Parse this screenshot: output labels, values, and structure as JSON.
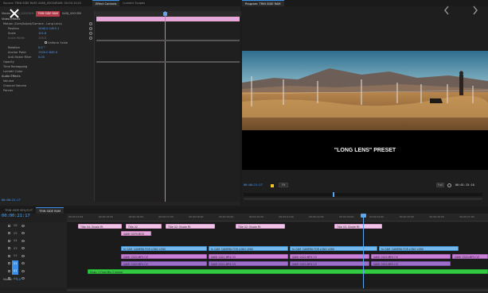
{
  "source_panel": {
    "header_text": "Source: TRIN SIDE RAM: SAMJ_00034RAM: 00:00:14:01",
    "tabs": [
      "Effect Controls",
      "Lumetri Scopes"
    ],
    "subtabs": [
      "Master",
      "TAMJ_00001RM",
      "TRIN SIDE RAM",
      "SAMJ_0001RM"
    ],
    "video_effects_label": "Video Effects",
    "effect_rows": [
      {
        "label": "Motion (Cam/Adjust/Camera - Long Lens)",
        "value": ""
      },
      {
        "label": "Position",
        "value": "1040.0  1455.1"
      },
      {
        "label": "Scale",
        "value": "101.6"
      },
      {
        "label": "Scale Width",
        "value": "100.0"
      },
      {
        "label": "Uniform Scale",
        "value": ""
      },
      {
        "label": "Rotation",
        "value": "0.0 °"
      },
      {
        "label": "Anchor Point",
        "value": "1320.0  849.0"
      },
      {
        "label": "Anti-flicker Filter",
        "value": "0.00"
      },
      {
        "label": "Opacity",
        "value": ""
      },
      {
        "label": "Time Remapping",
        "value": ""
      },
      {
        "label": "Lumetri Color",
        "value": ""
      }
    ],
    "audio_effects_label": "Audio Effects",
    "audio_rows": [
      "Volume",
      "Channel Volume",
      "Panner"
    ],
    "timecode": "00:00:21:17"
  },
  "program_monitor": {
    "title": "Program: TRIN SIDE RAM",
    "caption": "\"LONG LENS\" PRESET",
    "timecode": "00:00:21:17",
    "fit_label": "Fit",
    "full_label": "Full",
    "duration": "00:01:15:10"
  },
  "timeline": {
    "tabs": [
      "TRIN SIDE SEQ/CUT",
      "TRIN SIDE RAM"
    ],
    "timecode": "00:00:21:17",
    "ruler_ticks": [
      "00:00:14:04",
      "00:00:15:00",
      "00:00:16:00",
      "00:00:17:00",
      "00:00:18:00",
      "00:00:19:00",
      "00:00:20:00",
      "00:00:21:00",
      "00:00:22:00",
      "00:00:23:00",
      "00:00:24:00",
      "00:00:25:00",
      "00:00:26:00",
      "00:00:27:00"
    ],
    "tracks": [
      {
        "name": "V6"
      },
      {
        "name": "V5"
      },
      {
        "name": "V4"
      },
      {
        "name": "V3"
      },
      {
        "name": "V2"
      },
      {
        "name": "V1"
      },
      {
        "name": "A1"
      },
      {
        "name": "A2"
      }
    ],
    "master_label": "Master",
    "master_value": "0.0",
    "clips": [
      {
        "label": "Title 04: Single Fit",
        "track": 0,
        "color": "pinklight"
      },
      {
        "label": "Title 02",
        "track": 0,
        "color": "pinklight"
      },
      {
        "label": "Title 02: Single Fit",
        "track": 0,
        "color": "pinklight"
      },
      {
        "label": "Title 02: Single Fit",
        "track": 0,
        "color": "pinklight"
      },
      {
        "label": "Title 03: Single Fit",
        "track": 0,
        "color": "pinklight"
      },
      {
        "label": "SAMJ_0079.MOV",
        "track": 1,
        "color": "pink"
      },
      {
        "label": "fx CAM_CAMERA FOR LONG LENS",
        "track": 3,
        "color": "blue"
      },
      {
        "label": "fx CAM_CAMERA FOR LONG LENS",
        "track": 3,
        "color": "blue"
      },
      {
        "label": "fx CAM_CAMERA FOR LONG LENS",
        "track": 3,
        "color": "blue"
      },
      {
        "label": "fx CAM_CAMERA FOR LONG LENS",
        "track": 3,
        "color": "blue"
      },
      {
        "label": "SAMJ_0020.MP4 [V]",
        "track": 4,
        "color": "purple"
      },
      {
        "label": "SAMJ_0021.MP4 [V]",
        "track": 4,
        "color": "purple"
      },
      {
        "label": "SAMJ_0022.MP4 [V]",
        "track": 4,
        "color": "purple"
      },
      {
        "label": "SAMJ_0023.MP4 [V]",
        "track": 4,
        "color": "purple"
      },
      {
        "label": "SAMJ_0024.MP4 [V]",
        "track": 4,
        "color": "purple"
      },
      {
        "label": "SAMJ_0020.MP4 [V]",
        "track": 5,
        "color": "violet"
      },
      {
        "label": "SAMJ_0021.MP4 [V]",
        "track": 5,
        "color": "violet"
      },
      {
        "label": "SAMJ_0023.MP4 [V]",
        "track": 5,
        "color": "violet"
      },
      {
        "label": "SAMJ_0024.MP4 [V]",
        "track": 5,
        "color": "violet"
      },
      {
        "label": "Music 1 Final Mix 2 mixed",
        "track": 6,
        "color": "green"
      }
    ]
  },
  "colors": {
    "accent": "#3a8fe8",
    "timecode": "#f0c326",
    "playhead": "#5aa6f0"
  },
  "icons": [
    "close-icon",
    "back-chevron-icon",
    "forward-chevron-icon",
    "play-icon",
    "settings-icon"
  ]
}
